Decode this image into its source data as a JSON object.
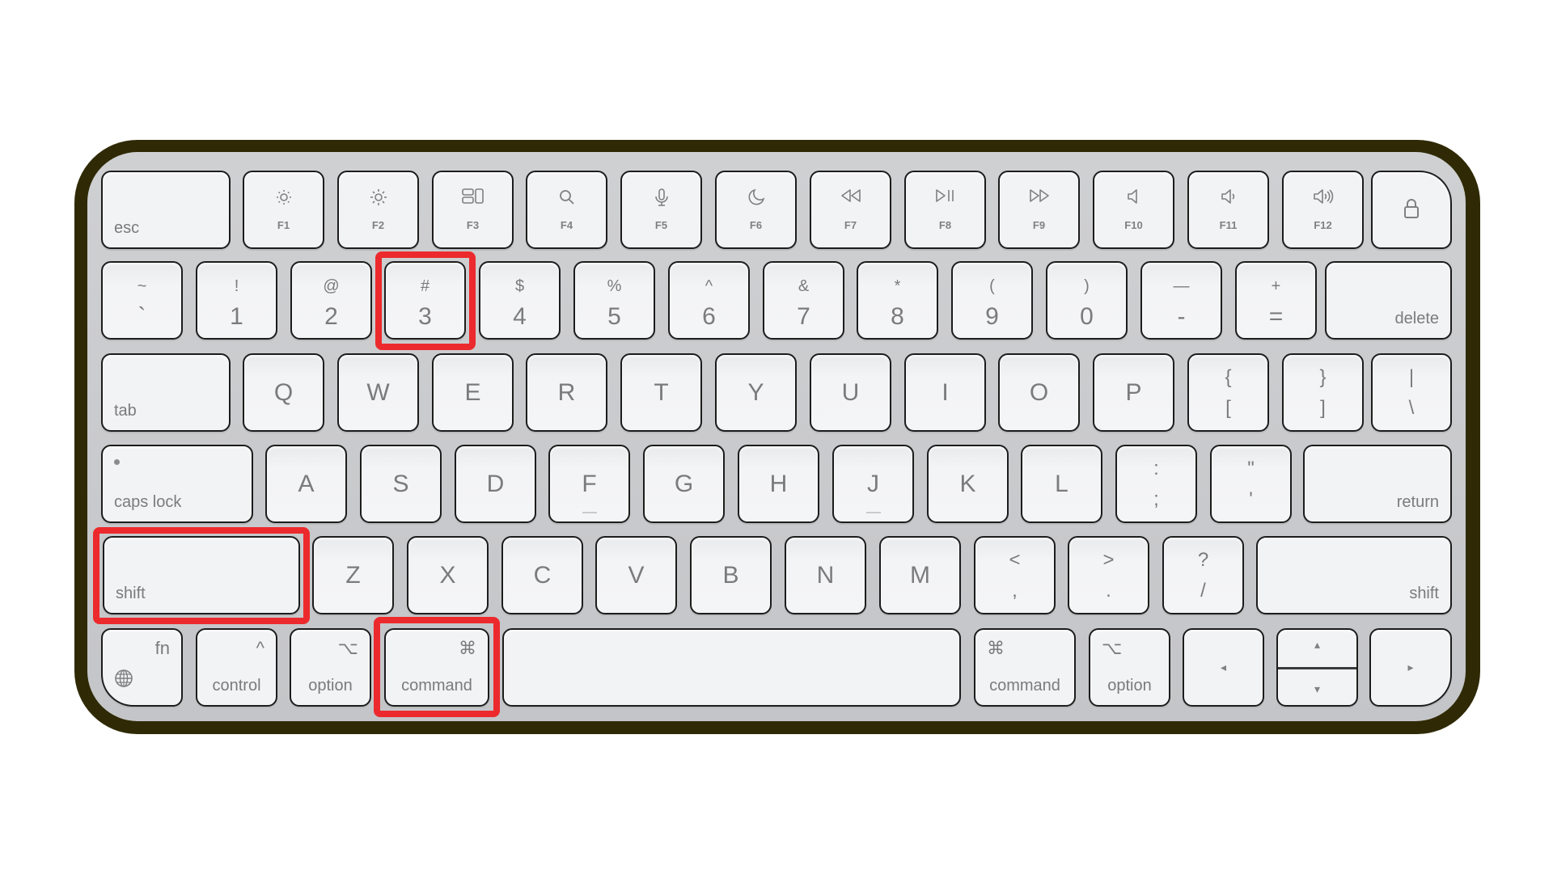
{
  "colors": {
    "frame": "#2f2a05",
    "deck": "#c8c9cb",
    "key_face": "#f2f3f5",
    "key_legend": "#7b7b7d",
    "highlight": "#ec2a2d"
  },
  "keyboard": {
    "function_row": {
      "esc": "esc",
      "keys": [
        {
          "label": "F1",
          "icon": "brightness-down-icon"
        },
        {
          "label": "F2",
          "icon": "brightness-up-icon"
        },
        {
          "label": "F3",
          "icon": "mission-control-icon"
        },
        {
          "label": "F4",
          "icon": "search-icon"
        },
        {
          "label": "F5",
          "icon": "microphone-icon"
        },
        {
          "label": "F6",
          "icon": "moon-icon"
        },
        {
          "label": "F7",
          "icon": "rewind-icon"
        },
        {
          "label": "F8",
          "icon": "play-pause-icon"
        },
        {
          "label": "F9",
          "icon": "fast-forward-icon"
        },
        {
          "label": "F10",
          "icon": "mute-icon"
        },
        {
          "label": "F11",
          "icon": "volume-down-icon"
        },
        {
          "label": "F12",
          "icon": "volume-up-icon"
        }
      ],
      "lock_icon": "lock-icon"
    },
    "number_row": {
      "keys": [
        {
          "top": "~",
          "bottom": "`"
        },
        {
          "top": "!",
          "bottom": "1"
        },
        {
          "top": "@",
          "bottom": "2"
        },
        {
          "top": "#",
          "bottom": "3"
        },
        {
          "top": "$",
          "bottom": "4"
        },
        {
          "top": "%",
          "bottom": "5"
        },
        {
          "top": "^",
          "bottom": "6"
        },
        {
          "top": "&",
          "bottom": "7"
        },
        {
          "top": "*",
          "bottom": "8"
        },
        {
          "top": "(",
          "bottom": "9"
        },
        {
          "top": ")",
          "bottom": "0"
        },
        {
          "top": "—",
          "bottom": "-"
        },
        {
          "top": "+",
          "bottom": "="
        }
      ],
      "delete": "delete"
    },
    "tab_row": {
      "tab": "tab",
      "letters": [
        "Q",
        "W",
        "E",
        "R",
        "T",
        "Y",
        "U",
        "I",
        "O",
        "P"
      ],
      "symbols": [
        {
          "top": "{",
          "bottom": "["
        },
        {
          "top": "}",
          "bottom": "]"
        },
        {
          "top": "|",
          "bottom": "\\"
        }
      ]
    },
    "home_row": {
      "caps_lock": "caps lock",
      "letters": [
        "A",
        "S",
        "D",
        "F",
        "G",
        "H",
        "J",
        "K",
        "L"
      ],
      "symbols": [
        {
          "top": ":",
          "bottom": ";"
        },
        {
          "top": "\"",
          "bottom": "'"
        }
      ],
      "return": "return"
    },
    "shift_row": {
      "left_shift": "shift",
      "letters": [
        "Z",
        "X",
        "C",
        "V",
        "B",
        "N",
        "M"
      ],
      "symbols": [
        {
          "top": "<",
          "bottom": ","
        },
        {
          "top": ">",
          "bottom": "."
        },
        {
          "top": "?",
          "bottom": "/"
        }
      ],
      "right_shift": "shift"
    },
    "bottom_row": {
      "fn": "fn",
      "globe_icon": "globe-icon",
      "control": "control",
      "control_symbol": "^",
      "option": "option",
      "option_symbol": "⌥",
      "command": "command",
      "command_symbol": "⌘",
      "arrows": {
        "left": "◂",
        "up": "▴",
        "down": "▾",
        "right": "▸"
      }
    }
  },
  "highlights": [
    "key-3",
    "left-shift",
    "left-command"
  ]
}
